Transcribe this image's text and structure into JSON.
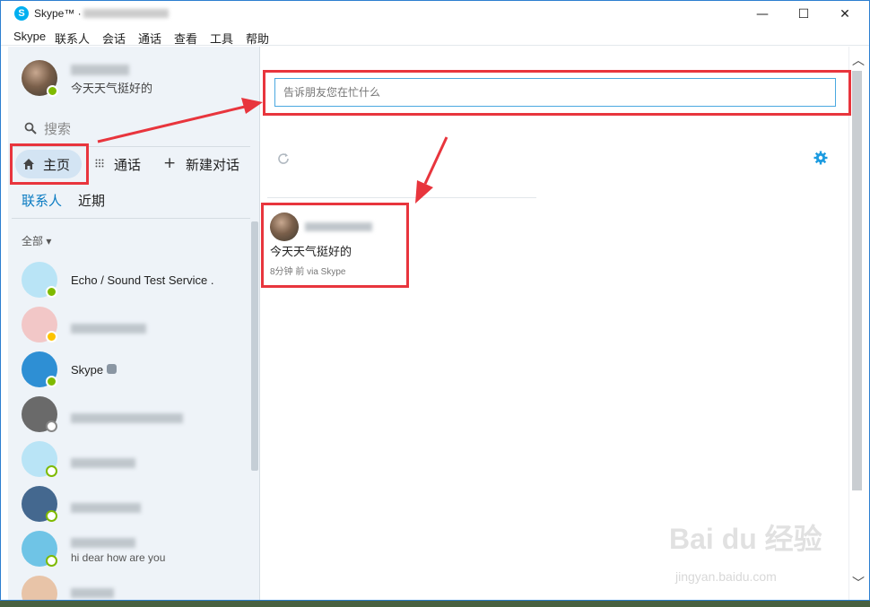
{
  "window": {
    "title": "Skype™ ·",
    "controls": {
      "minimize": "—",
      "maximize": "☐",
      "close": "✕"
    }
  },
  "menu": [
    "Skype",
    "联系人",
    "会话",
    "通话",
    "查看",
    "工具",
    "帮助"
  ],
  "profile": {
    "mood": "今天天气挺好的",
    "status": "online"
  },
  "search": {
    "label": "搜索"
  },
  "nav": {
    "home": "主页",
    "call": "通话",
    "new_chat": "新建对话"
  },
  "tabs": {
    "contacts": "联系人",
    "recent": "近期"
  },
  "filter": {
    "label": "全部"
  },
  "contacts": [
    {
      "name": "Echo / Sound Test Service .",
      "status": "online",
      "avatar_color": "#b9e4f6"
    },
    {
      "name": "",
      "status": "away",
      "avatar_color": "#f2c7c7"
    },
    {
      "name": "Skype",
      "status": "online",
      "verified": true,
      "avatar_color": "#2e8fd4"
    },
    {
      "name": "",
      "status": "unknown",
      "avatar_color": "#6a6a6a"
    },
    {
      "name": "",
      "status": "offline",
      "avatar_color": "#b9e4f6"
    },
    {
      "name": "",
      "status": "offline",
      "avatar_color": "#44688f"
    },
    {
      "name": "",
      "mood": "hi dear how are you",
      "status": "offline",
      "avatar_color": "#6fc4e6"
    },
    {
      "name": "",
      "status": "offline",
      "avatar_color": "#e8c4a8"
    }
  ],
  "main": {
    "mood_placeholder": "告诉朋友您在忙什么",
    "feed": {
      "text": "今天天气挺好的",
      "meta": "8分钟 前 via Skype"
    }
  },
  "watermark": {
    "brand": "Bai du 经验",
    "url": "jingyan.baidu.com"
  },
  "colors": {
    "accent": "#00aff0",
    "annotation": "#e8353d",
    "selected_tab": "#0a7bc2"
  }
}
